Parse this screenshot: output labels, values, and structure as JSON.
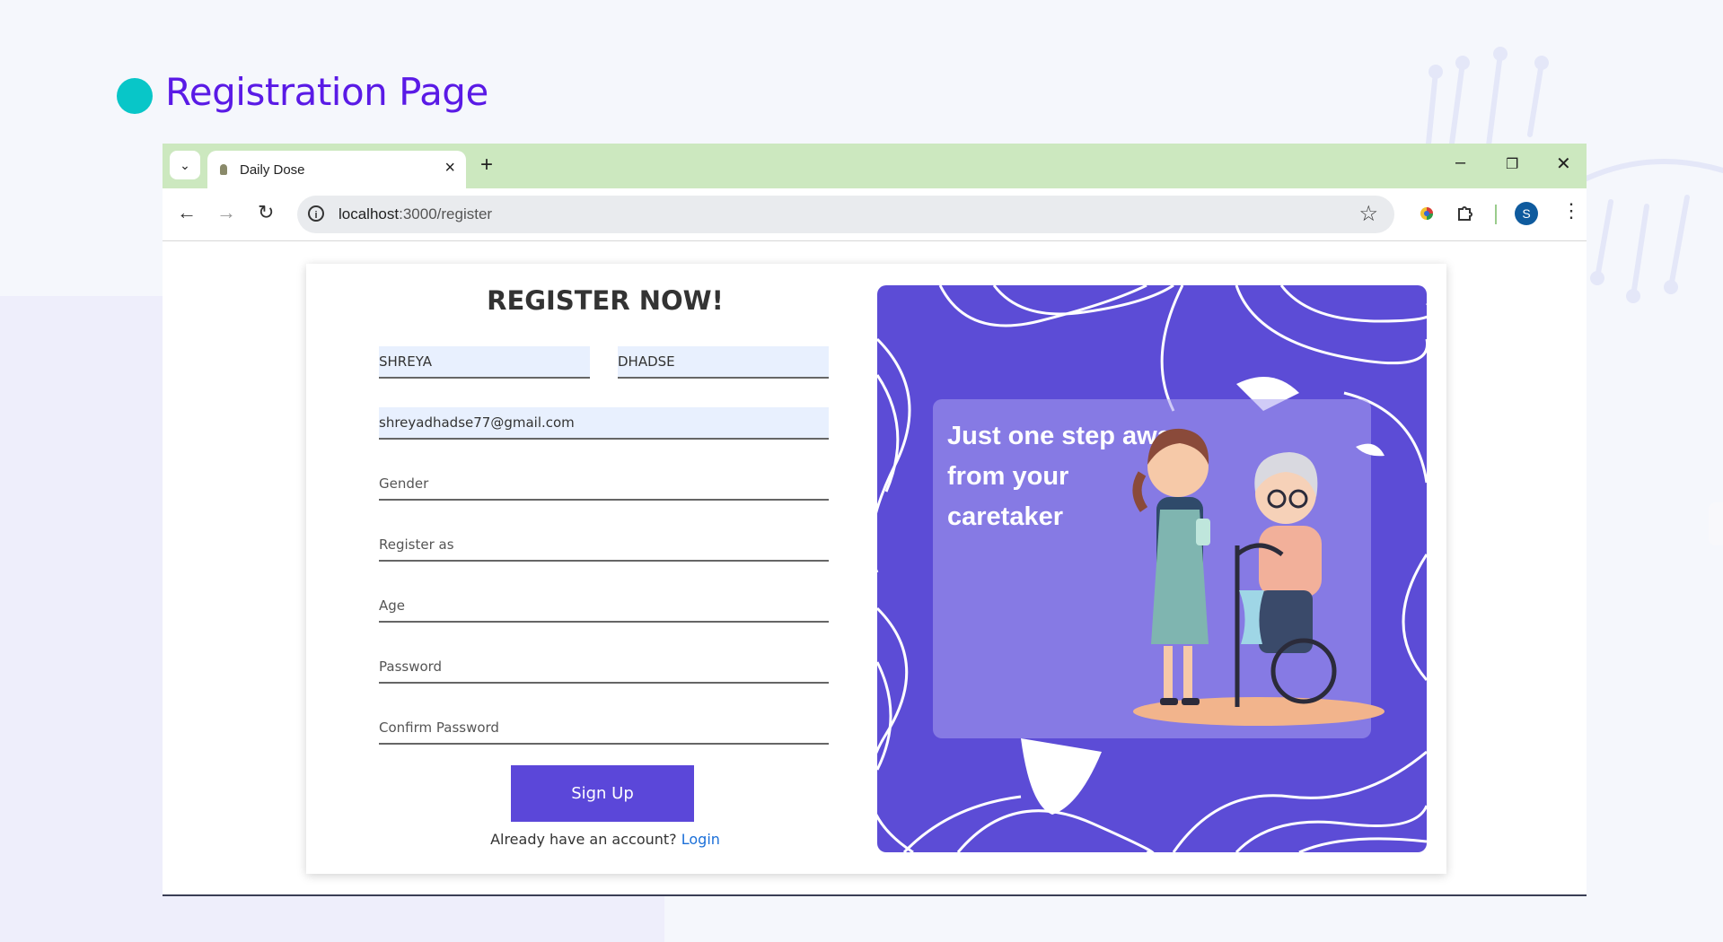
{
  "slide": {
    "title": "Registration Page"
  },
  "browser": {
    "tab_title": "Daily Dose",
    "url_host": "localhost",
    "url_path": ":3000/register",
    "avatar_initial": "S"
  },
  "form": {
    "heading": "REGISTER NOW!",
    "first_name": "SHREYA",
    "last_name": "DHADSE",
    "email": "shreyadhadse77@gmail.com",
    "gender_placeholder": "Gender",
    "register_as_placeholder": "Register as",
    "age_placeholder": "Age",
    "password_placeholder": "Password",
    "confirm_password_placeholder": "Confirm Password",
    "signup_label": "Sign Up",
    "account_prompt": "Already have an account?",
    "login_link": "Login"
  },
  "promo": {
    "tagline": "Just one step away from your caretaker"
  },
  "colors": {
    "accent": "#5b47d9",
    "title": "#5a1ae6",
    "dot": "#08c6c8",
    "tabbar": "#cce8bf"
  }
}
